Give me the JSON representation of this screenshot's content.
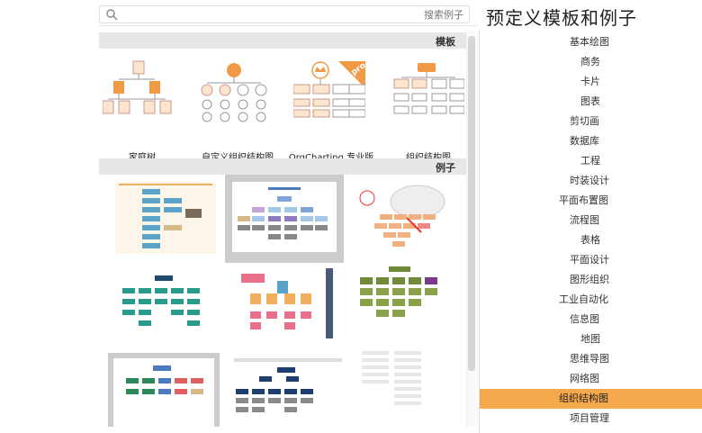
{
  "window_title": "预定义模板和例子",
  "search": {
    "placeholder": "搜索例子"
  },
  "sections": {
    "templates": "模板",
    "examples": "例子"
  },
  "templates": [
    {
      "label": "组织结构图"
    },
    {
      "label": "OrgCharting 专业版",
      "badge": "pro"
    },
    {
      "label": "自定义组织结构图"
    },
    {
      "label": "家庭树"
    }
  ],
  "sidebar": {
    "items": [
      {
        "label": "基本绘图"
      },
      {
        "label": "商务"
      },
      {
        "label": "卡片"
      },
      {
        "label": "图表"
      },
      {
        "label": "剪切画"
      },
      {
        "label": "数据库"
      },
      {
        "label": "工程"
      },
      {
        "label": "时装设计"
      },
      {
        "label": "平面布置图"
      },
      {
        "label": "流程图"
      },
      {
        "label": "表格"
      },
      {
        "label": "平面设计"
      },
      {
        "label": "图形组织"
      },
      {
        "label": "工业自动化"
      },
      {
        "label": "信息图"
      },
      {
        "label": "地图"
      },
      {
        "label": "思维导图"
      },
      {
        "label": "网络图"
      },
      {
        "label": "组织结构图"
      },
      {
        "label": "项目管理"
      }
    ],
    "active_index": 18,
    "active_color": "#f6a84d"
  },
  "examples": [
    {
      "name": "example-1"
    },
    {
      "name": "example-2"
    },
    {
      "name": "example-3"
    },
    {
      "name": "example-4"
    },
    {
      "name": "example-5"
    },
    {
      "name": "example-6"
    },
    {
      "name": "example-7"
    },
    {
      "name": "example-8"
    },
    {
      "name": "example-9"
    }
  ]
}
